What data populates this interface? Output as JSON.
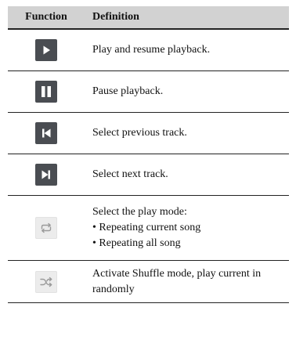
{
  "header": {
    "function_label": "Function",
    "definition_label": "Definition"
  },
  "rows": [
    {
      "icon": "play-icon",
      "definition": "Play and resume playback."
    },
    {
      "icon": "pause-icon",
      "definition": "Pause playback."
    },
    {
      "icon": "previous-track-icon",
      "definition": "Select previous track."
    },
    {
      "icon": "next-track-icon",
      "definition": "Select next track."
    },
    {
      "icon": "repeat-icon",
      "definition": "Select the play mode:",
      "bullets": [
        "• Repeating current song",
        "• Repeating all song"
      ]
    },
    {
      "icon": "shuffle-icon",
      "definition": "Activate Shuffle mode, play current in randomly"
    }
  ],
  "colors": {
    "header_background": "#d2d2d2",
    "dark_icon_background": "#4a4d52",
    "light_icon_background": "#ececec"
  }
}
